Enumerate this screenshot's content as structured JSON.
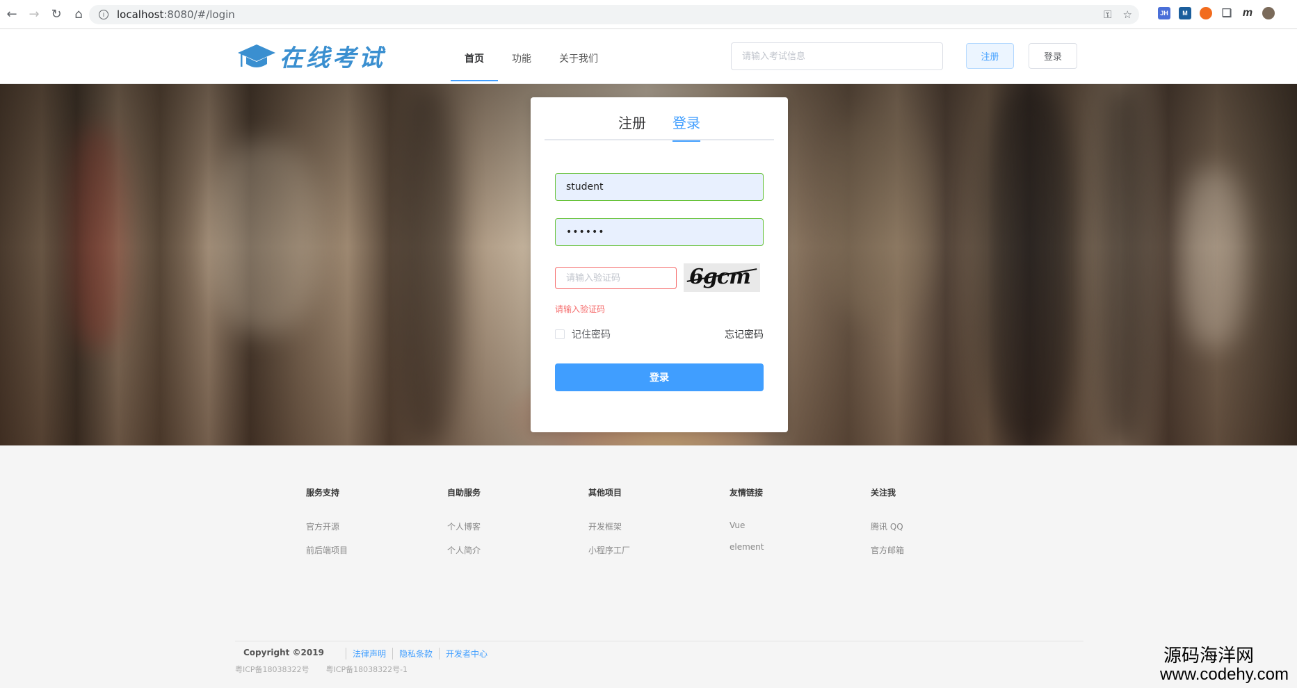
{
  "browser": {
    "url_host": "localhost",
    "url_rest": ":8080/#/login",
    "extensions": [
      {
        "label": "JH",
        "color": "#4a6fd8"
      },
      {
        "label": "M",
        "color": "#1b5e9c"
      },
      {
        "label": "",
        "color": "#f26b1d"
      }
    ]
  },
  "header": {
    "logo_text": "在线考试",
    "nav": [
      "首页",
      "功能",
      "关于我们"
    ],
    "search_placeholder": "请输入考试信息",
    "register_label": "注册",
    "login_label": "登录"
  },
  "login_card": {
    "tab_register": "注册",
    "tab_login": "登录",
    "username_value": "student",
    "password_value": "••••••",
    "captcha_placeholder": "请输入验证码",
    "captcha_text": "6gcm",
    "error_text": "请输入验证码",
    "remember_label": "记住密码",
    "forgot_label": "忘记密码",
    "submit_label": "登录"
  },
  "footer": {
    "columns": [
      {
        "title": "服务支持",
        "links": [
          "官方开源",
          "前后端项目"
        ]
      },
      {
        "title": "自助服务",
        "links": [
          "个人博客",
          "个人简介"
        ]
      },
      {
        "title": "其他项目",
        "links": [
          "开发框架",
          "小程序工厂"
        ]
      },
      {
        "title": "友情链接",
        "links": [
          "Vue",
          "element"
        ]
      },
      {
        "title": "关注我",
        "links": [
          "腾讯 QQ",
          "官方邮箱"
        ]
      }
    ],
    "copyright": "Copyright ©2019",
    "legal_links": [
      "法律声明",
      "隐私条款",
      "开发者中心"
    ],
    "icp": [
      "粤ICP备18038322号",
      "粤ICP备18038322号-1"
    ]
  },
  "watermark": {
    "line1": "源码海洋网",
    "line2": "www.codehy.com"
  },
  "colors": {
    "accent": "#409eff",
    "success_border": "#67c23a",
    "error": "#f56c6c",
    "logo": "#3a8fd0"
  }
}
